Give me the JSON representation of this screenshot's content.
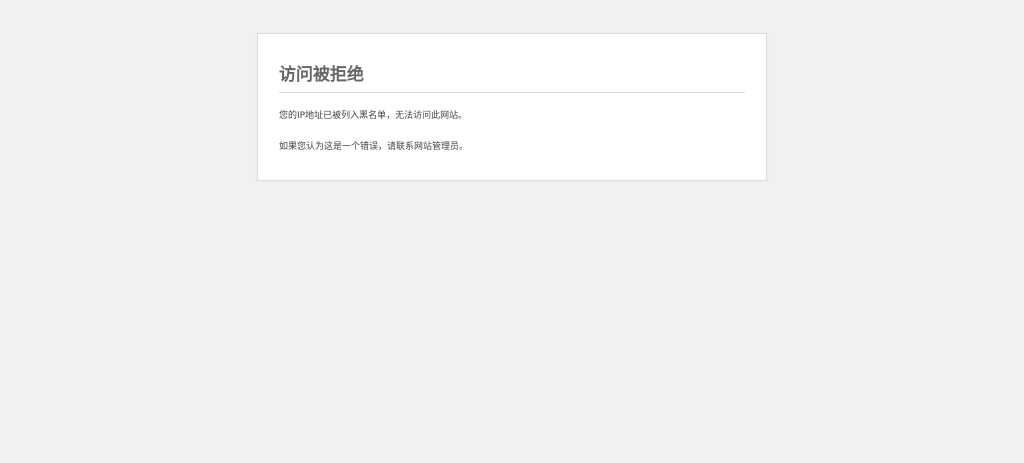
{
  "error": {
    "title": "访问被拒绝",
    "message": "您的IP地址已被列入黑名单，无法访问此网站。",
    "contact": "如果您认为这是一个错误，请联系网站管理员。"
  }
}
